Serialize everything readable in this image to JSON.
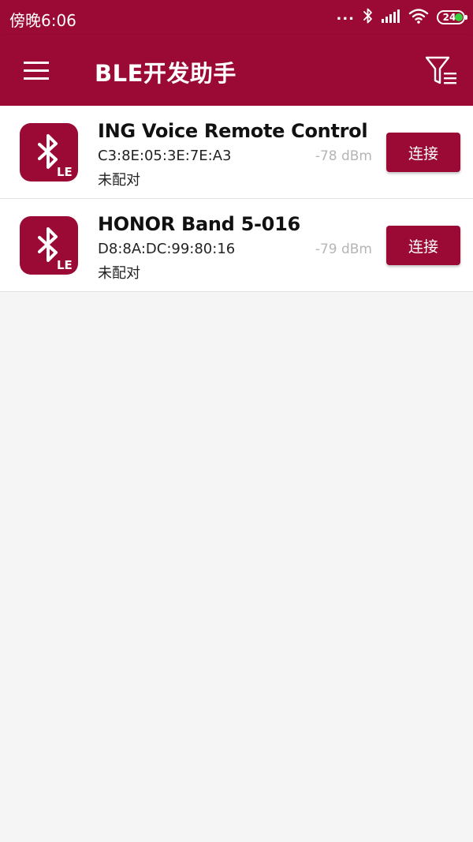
{
  "status_bar": {
    "time": "傍晚6:06",
    "dots": "...",
    "battery_level": "24",
    "icons": [
      "bluetooth-icon",
      "signal-icon",
      "wifi-icon",
      "battery-icon"
    ],
    "battery_indicator_color": "#36d03c"
  },
  "app_bar": {
    "title": "BLE开发助手",
    "left_icon": "menu-icon",
    "right_icon": "filter-icon"
  },
  "colors": {
    "primary": "#9b0a35",
    "background": "#f5f5f5",
    "rssi_text": "#b5b5b5"
  },
  "devices": [
    {
      "name": "ING Voice Remote Control",
      "mac": "C3:8E:05:3E:7E:A3",
      "bond": "未配对",
      "rssi": "-78 dBm",
      "button": "连接",
      "icon": "bluetooth-le-icon",
      "icon_label": "LE"
    },
    {
      "name": "HONOR Band 5-016",
      "mac": "D8:8A:DC:99:80:16",
      "bond": "未配对",
      "rssi": "-79 dBm",
      "button": "连接",
      "icon": "bluetooth-le-icon",
      "icon_label": "LE"
    }
  ]
}
